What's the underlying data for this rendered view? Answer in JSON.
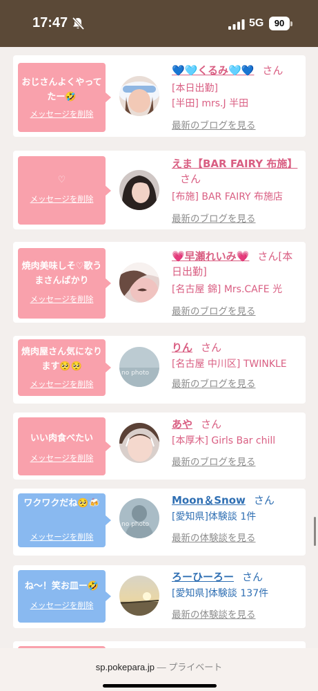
{
  "status": {
    "time": "17:47",
    "network": "5G",
    "battery": "90"
  },
  "messages": [
    {
      "bubble_color": "#f9a1ac",
      "message": "おじさんよくやってたー🤣",
      "delete_label": "メッセージを削除",
      "name": "💙🩵くるみ🩵💙",
      "honorific": "さん",
      "lines": [
        "[本日出勤]",
        "[半田] mrs.J 半田"
      ],
      "link": "最新のブログを見る",
      "name_color": "#d95e82"
    },
    {
      "bubble_color": "#f9a1ac",
      "message": "♡",
      "delete_label": "メッセージを削除",
      "name": "えま【BAR FAIRY 布施】",
      "honorific": "さん",
      "lines": [
        "[布施] BAR FAIRY 布施店"
      ],
      "link": "最新のブログを見る",
      "name_color": "#d95e82"
    },
    {
      "bubble_color": "#f9a1ac",
      "message": "焼肉美味しそ♡歌うまさんばかり",
      "delete_label": "メッセージを削除",
      "name": "💗早瀬れいみ💗",
      "honorific": "さん",
      "lines": [
        "[本日出勤]",
        "[名古屋 錦] Mrs.CAFE 光"
      ],
      "link": "最新のブログを見る",
      "name_color": "#d95e82"
    },
    {
      "bubble_color": "#f9a1ac",
      "message": "焼肉屋さん気になります🥺🥺",
      "delete_label": "メッセージを削除",
      "name": "りん",
      "honorific": "さん",
      "lines": [
        "[名古屋 中川区] TWINKLE"
      ],
      "link": "最新のブログを見る",
      "name_color": "#d95e82",
      "avatar_text": "no photo"
    },
    {
      "bubble_color": "#f9a1ac",
      "message": "いい肉食べたい",
      "delete_label": "メッセージを削除",
      "name": "あや",
      "honorific": "さん",
      "lines": [
        "[本厚木] Girls Bar chill"
      ],
      "link": "最新のブログを見る",
      "name_color": "#d95e82"
    },
    {
      "bubble_color": "#89b9f0",
      "message": "ワクワクだね🥺🍻",
      "delete_label": "メッセージを削除",
      "name": "Moon＆Snow",
      "honorific": "さん",
      "lines": [
        "[愛知県]体験談 1件"
      ],
      "link": "最新の体験談を見る",
      "name_color": "#2f6fb3",
      "avatar_text": "no photo"
    },
    {
      "bubble_color": "#89b9f0",
      "message": "ね〜！笑お皿ー🤣",
      "delete_label": "メッセージを削除",
      "name": "ろーひーろー",
      "honorific": "さん",
      "lines": [
        "[愛知県]体験談 137件"
      ],
      "link": "最新の体験談を見る",
      "name_color": "#2f6fb3"
    }
  ],
  "browser": {
    "domain": "sp.pokepara.jp",
    "separator": "—",
    "mode": "プライベート"
  }
}
